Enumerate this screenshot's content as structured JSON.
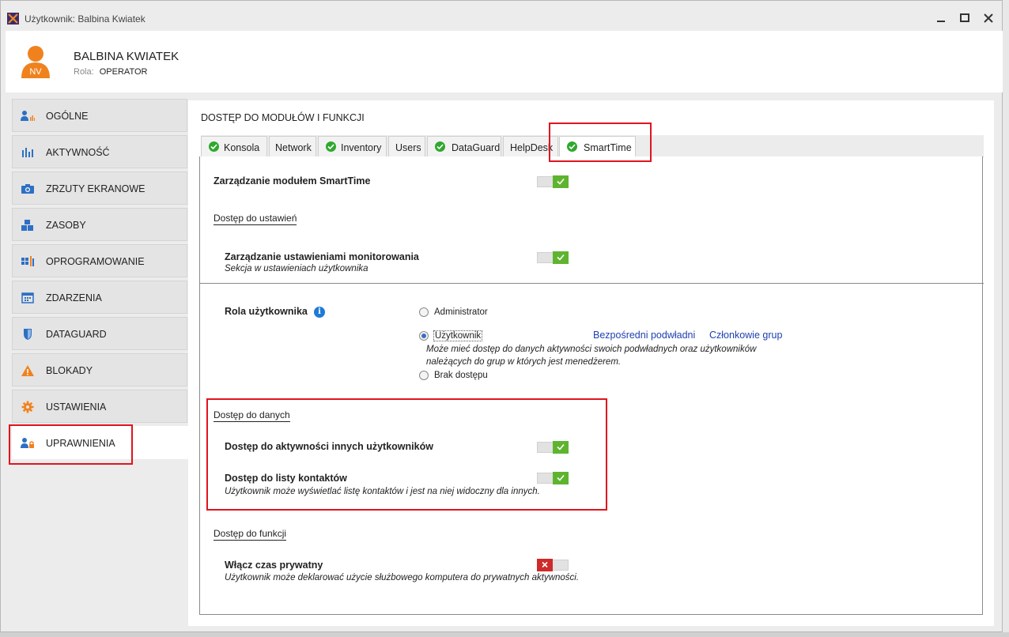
{
  "window": {
    "title": "Użytkownik: Balbina Kwiatek",
    "controls": {
      "minimize": "—",
      "maximize": "☐",
      "close": "✕"
    }
  },
  "header": {
    "avatar_initials": "NV",
    "user_name": "BALBINA KWIATEK",
    "role_label": "Rola:",
    "role_value": "OPERATOR"
  },
  "sidebar": {
    "items": [
      {
        "label": "OGÓLNE",
        "icon": "user-chart-icon"
      },
      {
        "label": "AKTYWNOŚĆ",
        "icon": "bar-chart-icon"
      },
      {
        "label": "ZRZUTY EKRANOWE",
        "icon": "camera-icon"
      },
      {
        "label": "ZASOBY",
        "icon": "cubes-icon"
      },
      {
        "label": "OPROGRAMOWANIE",
        "icon": "apps-icon"
      },
      {
        "label": "ZDARZENIA",
        "icon": "calendar-icon"
      },
      {
        "label": "DATAGUARD",
        "icon": "shield-icon"
      },
      {
        "label": "BLOKADY",
        "icon": "warning-icon"
      },
      {
        "label": "USTAWIENIA",
        "icon": "gear-icon"
      },
      {
        "label": "UPRAWNIENIA",
        "icon": "user-lock-icon",
        "active": true
      }
    ]
  },
  "main": {
    "section_title": "DOSTĘP DO MODUŁÓW I FUNKCJI",
    "tabs": [
      {
        "label": "Konsola",
        "checked": true
      },
      {
        "label": "Network",
        "checked": false
      },
      {
        "label": "Inventory",
        "checked": true
      },
      {
        "label": "Users",
        "checked": false
      },
      {
        "label": "DataGuard",
        "checked": true
      },
      {
        "label": "HelpDesk",
        "checked": false
      },
      {
        "label": "SmartTime",
        "checked": true,
        "active": true
      }
    ],
    "module_management": {
      "label": "Zarządzanie modułem SmartTime",
      "enabled": true
    },
    "settings_group": {
      "title": "Dostęp do ustawień",
      "monitoring": {
        "label": "Zarządzanie ustawieniami monitorowania",
        "sub": "Sekcja w ustawieniach użytkownika",
        "enabled": true
      }
    },
    "user_role": {
      "label": "Rola użytkownika",
      "info_icon": "i",
      "options": [
        {
          "label": "Administrator",
          "checked": false
        },
        {
          "label": "Użytkownik",
          "checked": true
        },
        {
          "label": "Brak dostępu",
          "checked": false
        }
      ],
      "user_description_line1": "Może mieć dostęp do danych aktywności swoich podwładnych oraz użytkowników",
      "user_description_line2": "należących do grup w których jest menedżerem.",
      "link_subordinates": "Bezpośredni podwładni",
      "link_group_members": "Członkowie grup"
    },
    "data_group": {
      "title": "Dostęp do danych",
      "activities": {
        "label": "Dostęp do aktywności innych użytkowników",
        "enabled": true
      },
      "contacts": {
        "label": "Dostęp do listy kontaktów",
        "sub": "Użytkownik może wyświetlać listę kontaktów i jest na niej widoczny dla innych.",
        "enabled": true
      }
    },
    "functions_group": {
      "title": "Dostęp do funkcji",
      "private_time": {
        "label": "Włącz czas prywatny",
        "sub": "Użytkownik może deklarować użycie służbowego komputera do prywatnych aktywności.",
        "enabled": false
      }
    }
  },
  "colors": {
    "toggle_on": "#5fb42f",
    "toggle_off": "#cf2a2a",
    "tab_check": "#2fa82f",
    "link": "#1e3fb0",
    "highlight_box": "#e0141e",
    "avatar": "#f0821e"
  }
}
